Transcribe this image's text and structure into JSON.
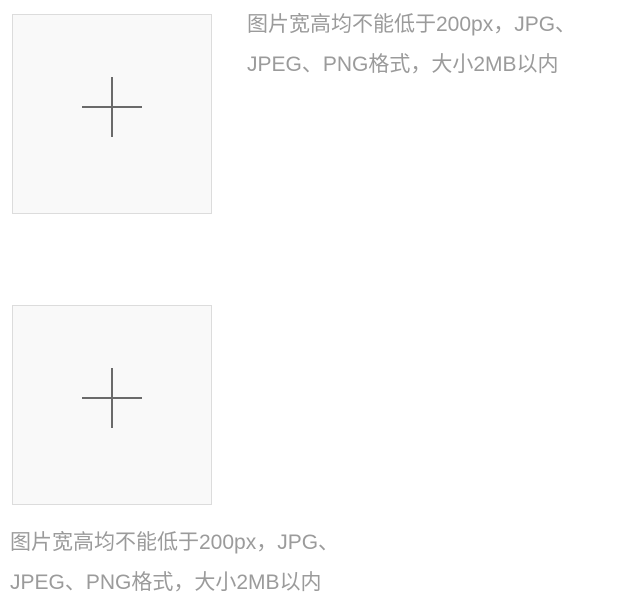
{
  "uploaders": [
    {
      "icon": "plus-icon",
      "hint_line1": "图片宽高均不能低于200px，JPG、",
      "hint_line2": "JPEG、PNG格式，大小2MB以内"
    },
    {
      "icon": "plus-icon",
      "hint_line1": "图片宽高均不能低于200px，JPG、",
      "hint_line2": "JPEG、PNG格式，大小2MB以内"
    }
  ],
  "colors": {
    "border": "#dcdcdc",
    "box_background": "#f9f9f9",
    "icon": "#6a6a6a",
    "hint_text": "#9b9b9b"
  }
}
